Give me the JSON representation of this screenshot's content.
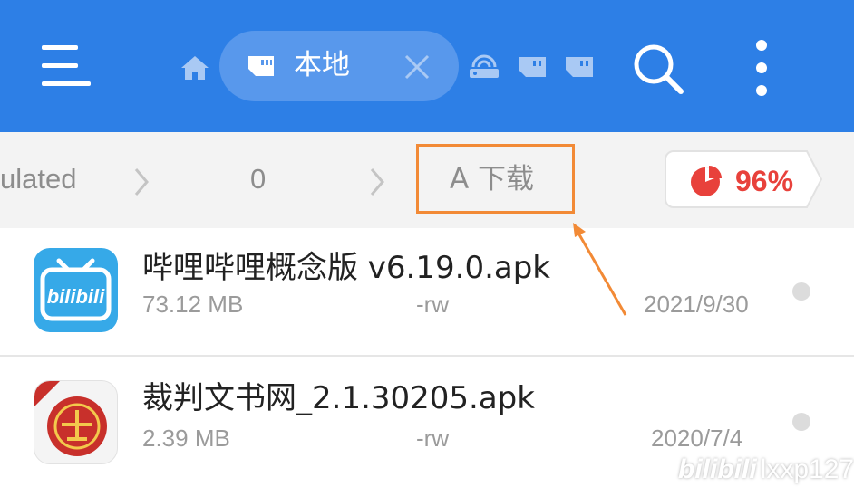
{
  "toolbar": {
    "tab_label": "本地",
    "colors": {
      "bar": "#2d7fe6",
      "pill": "#5898ec"
    },
    "icons": [
      "menu-icon",
      "home-icon",
      "sd-card-icon",
      "close-icon",
      "network-icon",
      "sd-card-icon",
      "sd-card-icon",
      "search-icon",
      "more-vertical-icon"
    ]
  },
  "breadcrumb": {
    "items": [
      "ulated",
      "0",
      "A 下载"
    ],
    "usage_percent": "96%",
    "usage_fraction": 0.96,
    "highlight_color": "#f28a36",
    "usage_color": "#e8413b"
  },
  "files": [
    {
      "name": "哔哩哔哩概念版 v6.19.0.apk",
      "size": "73.12 MB",
      "permission": "-rw",
      "date": "2021/9/30",
      "icon": "bilibili-app-icon",
      "icon_text": "bilibili"
    },
    {
      "name": "裁判文书网_2.1.30205.apk",
      "size": "2.39 MB",
      "permission": "-rw",
      "date": "2020/7/4",
      "icon": "court-document-app-icon"
    }
  ],
  "watermark": {
    "logo": "bilibili",
    "user": "lxxp127"
  }
}
